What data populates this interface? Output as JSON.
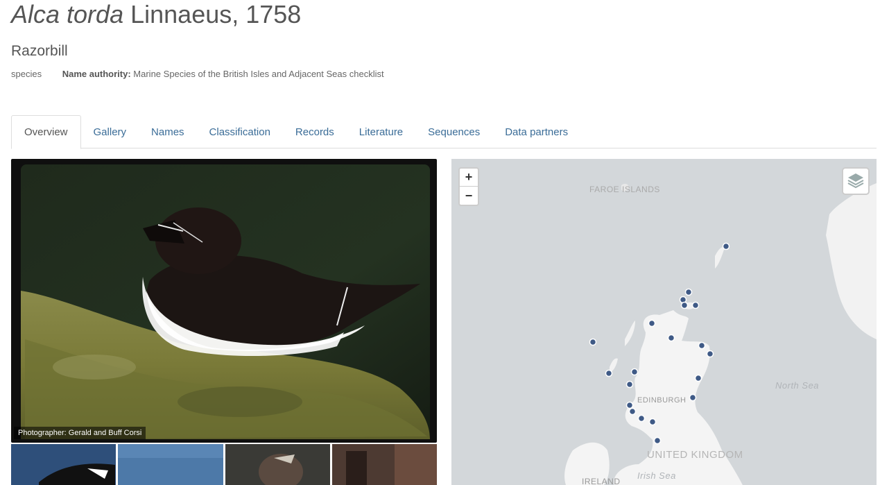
{
  "header": {
    "scientific_name": "Alca torda",
    "authority": "Linnaeus, 1758",
    "common_name": "Razorbill",
    "rank": "species",
    "name_authority_label": "Name authority:",
    "name_authority_value": "Marine Species of the British Isles and Adjacent Seas checklist"
  },
  "tabs": [
    {
      "label": "Overview",
      "active": true
    },
    {
      "label": "Gallery"
    },
    {
      "label": "Names"
    },
    {
      "label": "Classification"
    },
    {
      "label": "Records"
    },
    {
      "label": "Literature"
    },
    {
      "label": "Sequences"
    },
    {
      "label": "Data partners"
    }
  ],
  "photo": {
    "credit": "Photographer: Gerald and Buff Corsi"
  },
  "map": {
    "zoom_in": "+",
    "zoom_out": "−",
    "labels": {
      "faroe": "FAROE ISLANDS",
      "north_sea": "North Sea",
      "edinburgh": "EDINBURGH",
      "uk": "UNITED KINGDOM",
      "irish_sea": "Irish Sea",
      "ireland": "IRELAND"
    },
    "colors": {
      "sea": "#d3d7da",
      "land": "#f2f2f2",
      "marker": "#3f5a86"
    }
  }
}
